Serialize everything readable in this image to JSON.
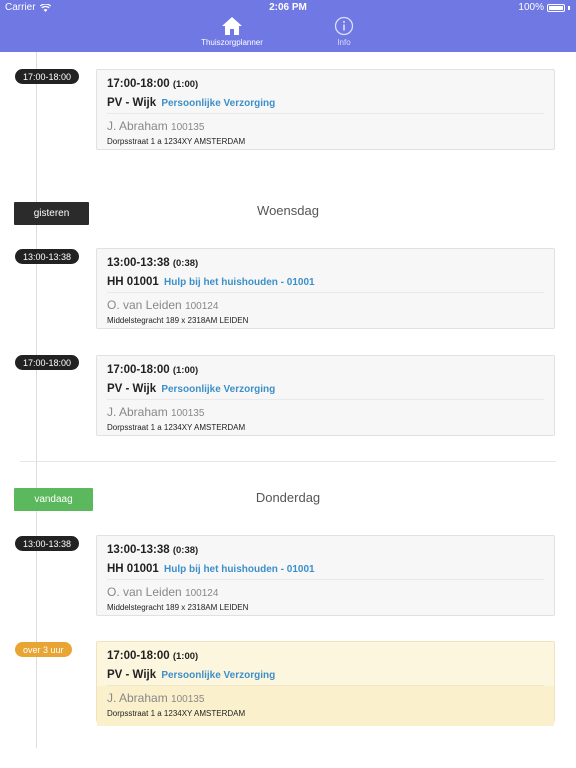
{
  "statusbar": {
    "carrier": "Carrier",
    "time": "2:06 PM",
    "battery": "100%"
  },
  "tabs": {
    "home_label": "Thuiszorgplanner",
    "info_label": "Info"
  },
  "days": {
    "yesterday": {
      "button": "gisteren",
      "title": "Woensdag"
    },
    "today": {
      "button": "vandaag",
      "title": "Donderdag"
    }
  },
  "appointments": [
    {
      "pill": "17:00-18:00",
      "time": "17:00-18:00",
      "duration": "(1:00)",
      "code": "PV - Wijk",
      "desc": "Persoonlijke Verzorging",
      "name": "J. Abraham",
      "client_id": "100135",
      "address": "Dorpsstraat 1 a 1234XY AMSTERDAM"
    },
    {
      "pill": "13:00-13:38",
      "time": "13:00-13:38",
      "duration": "(0:38)",
      "code": "HH 01001",
      "desc": "Hulp bij het huishouden - 01001",
      "name": "O. van Leiden",
      "client_id": "100124",
      "address": "Middelstegracht 189 x 2318AM LEIDEN"
    },
    {
      "pill": "17:00-18:00",
      "time": "17:00-18:00",
      "duration": "(1:00)",
      "code": "PV - Wijk",
      "desc": "Persoonlijke Verzorging",
      "name": "J. Abraham",
      "client_id": "100135",
      "address": "Dorpsstraat 1 a 1234XY AMSTERDAM"
    },
    {
      "pill": "13:00-13:38",
      "time": "13:00-13:38",
      "duration": "(0:38)",
      "code": "HH 01001",
      "desc": "Hulp bij het huishouden - 01001",
      "name": "O. van Leiden",
      "client_id": "100124",
      "address": "Middelstegracht 189 x 2318AM LEIDEN"
    },
    {
      "pill": "over 3 uur",
      "time": "17:00-18:00",
      "duration": "(1:00)",
      "code": "PV - Wijk",
      "desc": "Persoonlijke Verzorging",
      "name": "J. Abraham",
      "client_id": "100135",
      "address": "Dorpsstraat 1 a 1234XY AMSTERDAM"
    }
  ],
  "colors": {
    "header": "#6f78e3",
    "link": "#3d8fc9",
    "today": "#5cb85c",
    "upcoming": "#e8a534"
  }
}
